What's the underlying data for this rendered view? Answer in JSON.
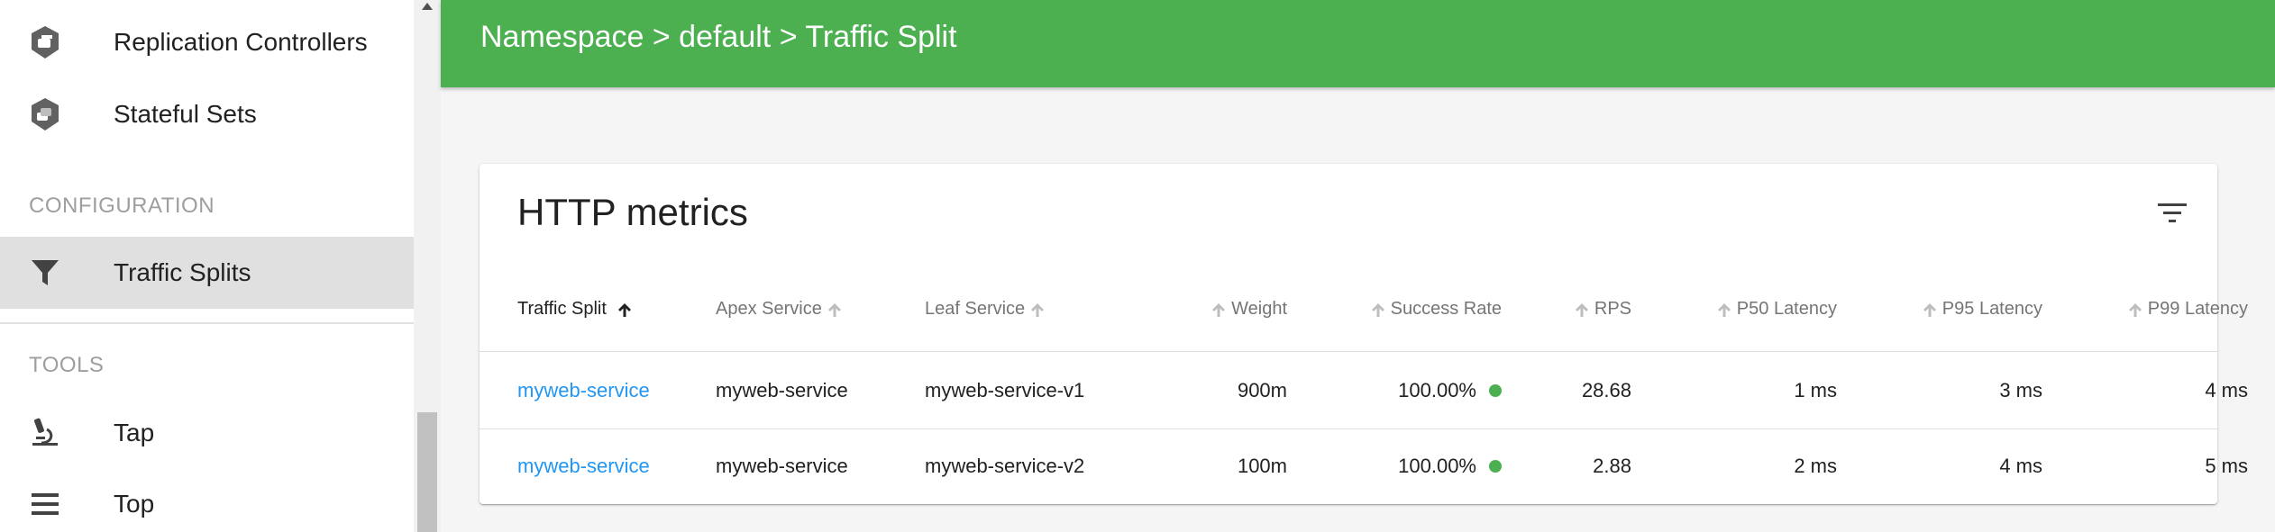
{
  "sidebar": {
    "items": [
      {
        "label": "Replication Controllers",
        "icon": "replication-controller-icon"
      },
      {
        "label": "Stateful Sets",
        "icon": "stateful-set-icon"
      }
    ],
    "configuration_header": "CONFIGURATION",
    "configuration_items": [
      {
        "label": "Traffic Splits",
        "icon": "filter-funnel-icon",
        "active": true
      }
    ],
    "tools_header": "TOOLS",
    "tools_items": [
      {
        "label": "Tap",
        "icon": "microscope-icon"
      },
      {
        "label": "Top",
        "icon": "list-lines-icon"
      }
    ]
  },
  "header": {
    "breadcrumb": "Namespace > default > Traffic Split",
    "color": "#4caf50"
  },
  "card": {
    "title": "HTTP metrics",
    "columns": [
      "Traffic Split",
      "Apex Service",
      "Leaf Service",
      "Weight",
      "Success Rate",
      "RPS",
      "P50 Latency",
      "P95 Latency",
      "P99 Latency"
    ],
    "sorted_column": "Traffic Split",
    "rows": [
      {
        "traffic_split": "myweb-service",
        "apex_service": "myweb-service",
        "leaf_service": "myweb-service-v1",
        "weight": "900m",
        "success_rate": "100.00%",
        "rps": "28.68",
        "p50": "1 ms",
        "p95": "3 ms",
        "p99": "4 ms"
      },
      {
        "traffic_split": "myweb-service",
        "apex_service": "myweb-service",
        "leaf_service": "myweb-service-v2",
        "weight": "100m",
        "success_rate": "100.00%",
        "rps": "2.88",
        "p50": "2 ms",
        "p95": "4 ms",
        "p99": "5 ms"
      }
    ]
  },
  "colors": {
    "accent": "#4caf50",
    "link": "#2196f3",
    "success_dot": "#4caf50"
  }
}
